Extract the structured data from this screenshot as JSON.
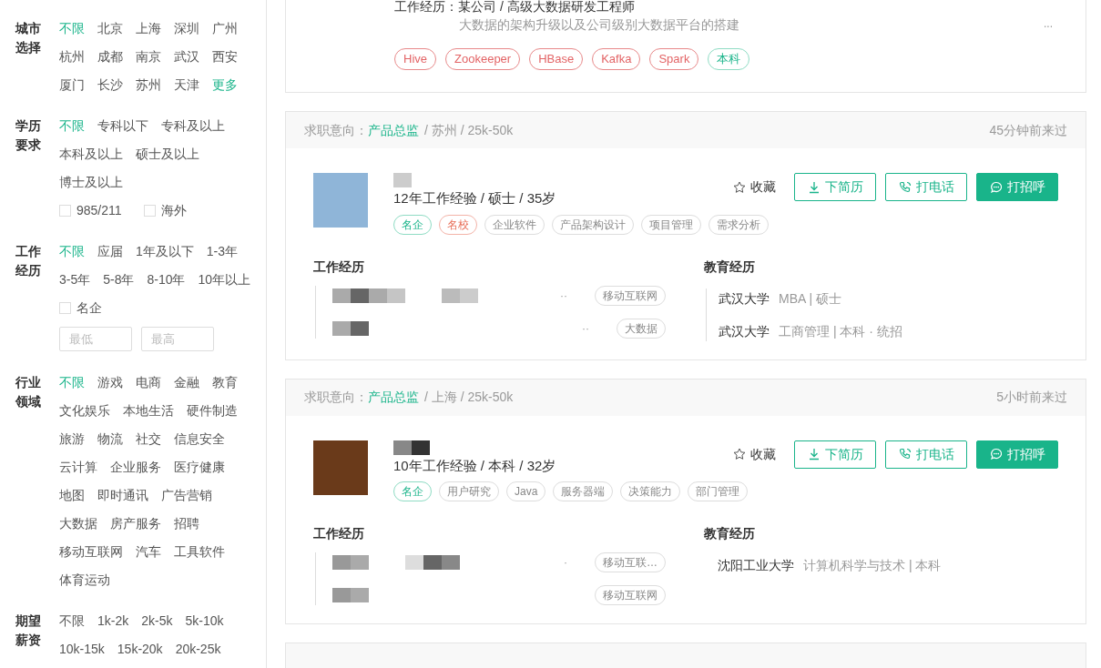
{
  "sidebar": {
    "filters": [
      {
        "label": "城市选择",
        "options": [
          {
            "label": "不限",
            "selected": true
          },
          {
            "label": "北京",
            "selected": false
          },
          {
            "label": "上海",
            "selected": false
          },
          {
            "label": "深圳",
            "selected": false
          },
          {
            "label": "广州",
            "selected": false
          },
          {
            "label": "杭州",
            "selected": false
          },
          {
            "label": "成都",
            "selected": false
          },
          {
            "label": "南京",
            "selected": false
          },
          {
            "label": "武汉",
            "selected": false
          },
          {
            "label": "西安",
            "selected": false
          },
          {
            "label": "厦门",
            "selected": false
          },
          {
            "label": "长沙",
            "selected": false
          },
          {
            "label": "苏州",
            "selected": false
          },
          {
            "label": "天津",
            "selected": false
          }
        ],
        "more_link": "更多"
      },
      {
        "label": "学历要求",
        "options": [
          {
            "label": "不限",
            "selected": true
          },
          {
            "label": "专科以下",
            "selected": false
          },
          {
            "label": "专科及以上",
            "selected": false
          },
          {
            "label": "本科及以上",
            "selected": false
          },
          {
            "label": "硕士及以上",
            "selected": false
          },
          {
            "label": "博士及以上",
            "selected": false
          }
        ],
        "checkboxes": [
          {
            "label": "985/211",
            "checked": false
          },
          {
            "label": "海外",
            "checked": false
          }
        ]
      },
      {
        "label": "工作经历",
        "options": [
          {
            "label": "不限",
            "selected": true
          },
          {
            "label": "应届",
            "selected": false
          },
          {
            "label": "1年及以下",
            "selected": false
          },
          {
            "label": "1-3年",
            "selected": false
          },
          {
            "label": "3-5年",
            "selected": false
          },
          {
            "label": "5-8年",
            "selected": false
          },
          {
            "label": "8-10年",
            "selected": false
          },
          {
            "label": "10年以上",
            "selected": false
          }
        ],
        "checkboxes": [
          {
            "label": "名企",
            "checked": false
          }
        ],
        "range": {
          "min_placeholder": "最低",
          "max_placeholder": "最高"
        }
      },
      {
        "label": "行业领域",
        "options": [
          {
            "label": "不限",
            "selected": true
          },
          {
            "label": "游戏",
            "selected": false
          },
          {
            "label": "电商",
            "selected": false
          },
          {
            "label": "金融",
            "selected": false
          },
          {
            "label": "教育",
            "selected": false
          },
          {
            "label": "文化娱乐",
            "selected": false
          },
          {
            "label": "本地生活",
            "selected": false
          },
          {
            "label": "硬件制造",
            "selected": false
          },
          {
            "label": "旅游",
            "selected": false
          },
          {
            "label": "物流",
            "selected": false
          },
          {
            "label": "社交",
            "selected": false
          },
          {
            "label": "信息安全",
            "selected": false
          },
          {
            "label": "云计算",
            "selected": false
          },
          {
            "label": "企业服务",
            "selected": false
          },
          {
            "label": "医疗健康",
            "selected": false
          },
          {
            "label": "地图",
            "selected": false
          },
          {
            "label": "即时通讯",
            "selected": false
          },
          {
            "label": "广告营销",
            "selected": false
          },
          {
            "label": "大数据",
            "selected": false
          },
          {
            "label": "房产服务",
            "selected": false
          },
          {
            "label": "招聘",
            "selected": false
          },
          {
            "label": "移动互联网",
            "selected": false
          },
          {
            "label": "汽车",
            "selected": false
          },
          {
            "label": "工具软件",
            "selected": false
          },
          {
            "label": "体育运动",
            "selected": false
          }
        ]
      },
      {
        "label": "期望薪资",
        "options": [
          {
            "label": "不限",
            "selected": false
          },
          {
            "label": "1k-2k",
            "selected": false
          },
          {
            "label": "2k-5k",
            "selected": false
          },
          {
            "label": "5k-10k",
            "selected": false
          },
          {
            "label": "10k-15k",
            "selected": false
          },
          {
            "label": "15k-20k",
            "selected": false
          },
          {
            "label": "20k-25k",
            "selected": false
          }
        ]
      }
    ]
  },
  "top_card": {
    "experience": "工作经历：某公司 / 高级大数据研发工程师",
    "description": "大数据的架构升级以及公司级别大数据平台的搭建",
    "more": "...",
    "tags": [
      {
        "label": "Hive",
        "kind": "skill"
      },
      {
        "label": "Zookeeper",
        "kind": "skill"
      },
      {
        "label": "HBase",
        "kind": "skill"
      },
      {
        "label": "Kafka",
        "kind": "skill"
      },
      {
        "label": "Spark",
        "kind": "skill"
      },
      {
        "label": "本科",
        "kind": "degree"
      }
    ]
  },
  "cards": [
    {
      "intent_label": "求职意向：",
      "position": "产品总监",
      "details": "/ 苏州 / 25k-50k",
      "last_seen": "45分钟前来过",
      "summary": "12年工作经验 / 硕士 / 35岁",
      "tags": [
        {
          "label": "名企",
          "kind": "company"
        },
        {
          "label": "名校",
          "kind": "school"
        },
        {
          "label": "企业软件",
          "kind": "skill"
        },
        {
          "label": "产品架构设计",
          "kind": "skill"
        },
        {
          "label": "项目管理",
          "kind": "skill"
        },
        {
          "label": "需求分析",
          "kind": "skill"
        }
      ],
      "favorite": "收藏",
      "buttons": [
        {
          "label": "下简历",
          "kind": "download"
        },
        {
          "label": "打电话",
          "kind": "call"
        },
        {
          "label": "打招呼",
          "kind": "greet"
        }
      ],
      "work_title": "工作经历",
      "work": [
        {
          "dots": "··",
          "tag": "移动互联网"
        },
        {
          "dots": "··",
          "tag": "大数据"
        }
      ],
      "edu_title": "教育经历",
      "education": [
        {
          "school": "武汉大学",
          "detail": "MBA | 硕士"
        },
        {
          "school": "武汉大学",
          "detail": "工商管理 | 本科 · 统招"
        }
      ]
    },
    {
      "intent_label": "求职意向：",
      "position": "产品总监",
      "details": "/ 上海 / 25k-50k",
      "last_seen": "5小时前来过",
      "summary": "10年工作经验 / 本科 / 32岁",
      "tags": [
        {
          "label": "名企",
          "kind": "company"
        },
        {
          "label": "用户研究",
          "kind": "skill"
        },
        {
          "label": "Java",
          "kind": "skill"
        },
        {
          "label": "服务器端",
          "kind": "skill"
        },
        {
          "label": "决策能力",
          "kind": "skill"
        },
        {
          "label": "部门管理",
          "kind": "skill"
        }
      ],
      "favorite": "收藏",
      "buttons": [
        {
          "label": "下简历",
          "kind": "download"
        },
        {
          "label": "打电话",
          "kind": "call"
        },
        {
          "label": "打招呼",
          "kind": "greet"
        }
      ],
      "work_title": "工作经历",
      "work": [
        {
          "dots": "·",
          "tag": "移动互联…"
        },
        {
          "tag": "移动互联网"
        }
      ],
      "edu_title": "教育经历",
      "education": [
        {
          "school": "沈阳工业大学",
          "detail": "计算机科学与技术 | 本科"
        }
      ]
    }
  ]
}
